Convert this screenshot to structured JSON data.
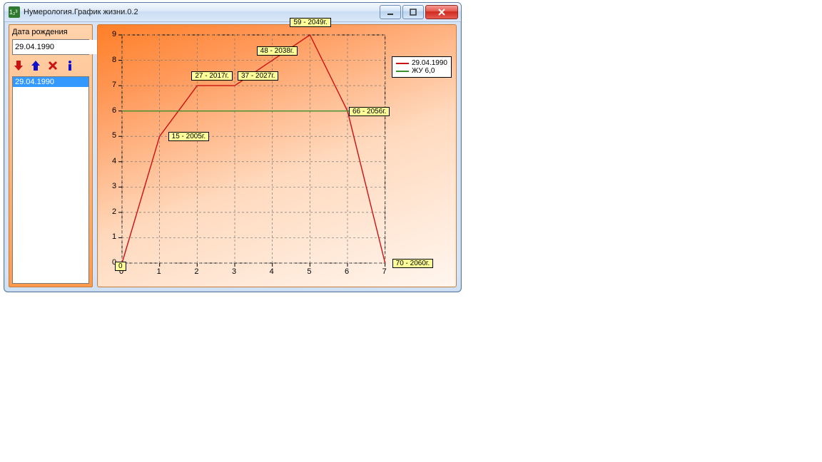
{
  "window": {
    "title": "Нумерология.График жизни.0.2"
  },
  "sidebar": {
    "label": "Дата рождения",
    "date_value": "29.04.1990",
    "list_item": "29.04.1990"
  },
  "legend": {
    "series1": "29.04.1990",
    "series2": "ЖУ 6,0"
  },
  "colors": {
    "series1": "#cc1111",
    "series2": "#3a8f2a",
    "label_bg": "#ffff99"
  },
  "chart_data": {
    "type": "line",
    "xlim": [
      0,
      7.5
    ],
    "ylim": [
      0,
      9
    ],
    "x_ticks": [
      0,
      1,
      2,
      3,
      4,
      5,
      6,
      7
    ],
    "y_ticks": [
      0,
      1,
      2,
      3,
      4,
      5,
      6,
      7,
      8,
      9
    ],
    "series": [
      {
        "name": "29.04.1990",
        "color": "#cc1111",
        "x": [
          0,
          1,
          2,
          3,
          4,
          5,
          6,
          7
        ],
        "y": [
          0,
          5,
          7,
          7,
          8,
          9,
          6,
          0
        ],
        "point_labels": [
          "0",
          "15 - 2005г.",
          "27 - 2017г.",
          "37 - 2027г.",
          "48 - 2038г.",
          "59 - 2049г.",
          "66 - 2056г.",
          "70 - 2060г."
        ]
      },
      {
        "name": "ЖУ 6,0",
        "color": "#3a8f2a",
        "x": [
          0,
          7
        ],
        "y": [
          6,
          6
        ]
      }
    ],
    "grid": true
  }
}
